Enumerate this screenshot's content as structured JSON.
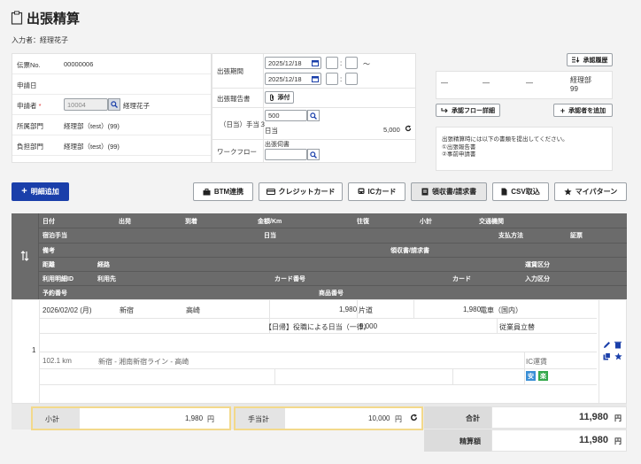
{
  "header": {
    "title": "出張精算",
    "input_user": "入力者：経理花子"
  },
  "left_info": {
    "rows": [
      {
        "label": "伝票No.",
        "value": "00000006"
      },
      {
        "label": "申請日",
        "value": ""
      },
      {
        "label": "申請者",
        "required": "*",
        "input": "10004",
        "value": "経理花子"
      },
      {
        "label": "所属部門",
        "value": "経理部（test）(99)"
      },
      {
        "label": "負担部門",
        "value": "経理部（test）(99)"
      }
    ]
  },
  "mid_info": {
    "period_label": "出張期間",
    "date1": "2025/12/18",
    "date2": "2025/12/18",
    "tilde": "〜",
    "colon": ":",
    "report_label": "出張報告書",
    "attach_label": "添付",
    "allowance_label": "（日当）手当３",
    "allowance_input": "500",
    "daily_label": "日当",
    "daily_value": "5,000",
    "workflow_label": "ワークフロー",
    "trip_request_label": "出張伺書"
  },
  "right_info": {
    "history_button": "承認履歴",
    "approvers": [
      "—",
      "—",
      "—",
      "経理部\n99"
    ],
    "flow_detail_button": "承認フロー詳細",
    "add_approver_button": "承認者を追加",
    "note": "出張精算時には以下の書類を提出してください。\n①出張報告書\n②事前申請書"
  },
  "toolbar": {
    "add_detail": "明細追加",
    "btm": "BTM連携",
    "credit": "クレジットカード",
    "ic": "ICカード",
    "receipt": "領収書/請求書",
    "csv": "CSV取込",
    "my_pattern": "マイパターン"
  },
  "table_header": {
    "row1": [
      "日付",
      "出発",
      "到着",
      "金額/Km",
      "往復",
      "小計",
      "交通機関"
    ],
    "row2": [
      "宿泊手当",
      "日当",
      "支払方法",
      "証票"
    ],
    "row3": [
      "備考",
      "領収書/請求書"
    ],
    "row4": [
      "距離",
      "経路",
      "運賃区分"
    ],
    "row5": [
      "利用明細ID",
      "利用先",
      "カード番号",
      "カード",
      "入力区分"
    ],
    "row6": [
      "予約番号",
      "商品番号"
    ]
  },
  "table_row": {
    "index": "1",
    "date": "2026/02/02 (月)",
    "from": "新宿",
    "to": "高崎",
    "amount": "1,980",
    "roundtrip": "片道",
    "subtotal": "1,980",
    "transport": "電車（国内）",
    "daily_note": "【日帰】役職による日当（一律）",
    "daily_amount": "5,000",
    "payment": "従業員立替",
    "distance": "102.1 km",
    "route": "新宿 - 湘南新宿ライン - 高崎",
    "fare_type": "IC運賃",
    "badge1": "安",
    "badge2": "楽"
  },
  "footer": {
    "subtotal_label": "小計",
    "subtotal_value": "1,980",
    "yen": "円",
    "allowance_label": "手当計",
    "allowance_value": "10,000",
    "total_label": "合計",
    "total_value": "11,980",
    "settle_label": "精算額",
    "settle_value": "11,980"
  },
  "colors": {
    "primary": "#1a3faa",
    "table_header": "#6b6b6b",
    "highlight": "#f3d98b",
    "badge_blue": "#3a8fd6",
    "badge_green": "#33a84a"
  }
}
